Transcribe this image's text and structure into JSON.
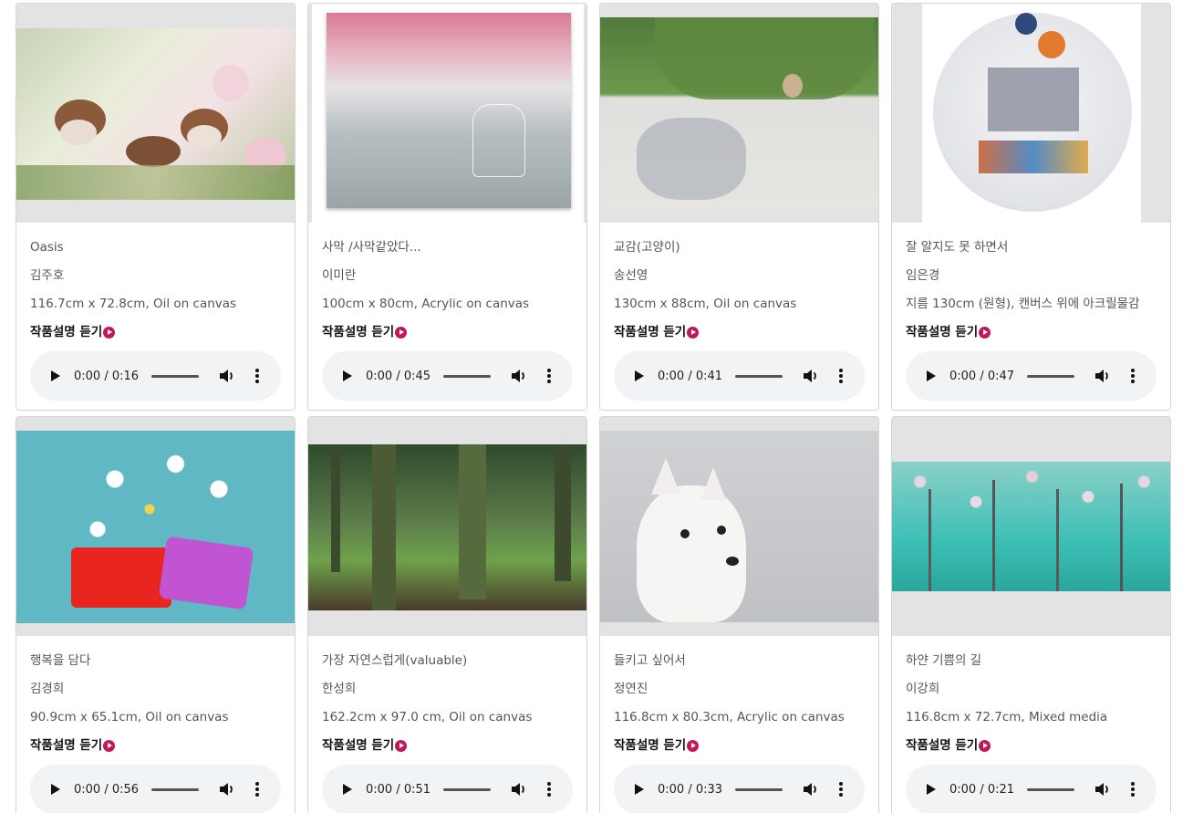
{
  "listen_label": "작품설명 듣기",
  "accent_color": "#c2185b",
  "artworks": [
    {
      "title": "Oasis",
      "artist": "김주호",
      "spec": "116.7cm x 72.8cm, Oil on canvas",
      "time": "0:00 / 0:16"
    },
    {
      "title": "사막 /사막같았다...",
      "artist": "이미란",
      "spec": "100cm x 80cm, Acrylic on canvas",
      "time": "0:00 / 0:45"
    },
    {
      "title": "교감(고양이)",
      "artist": "송선영",
      "spec": "130cm x 88cm, Oil on canvas",
      "time": "0:00 / 0:41"
    },
    {
      "title": "잘 알지도 못 하면서",
      "artist": "임은경",
      "spec": "지름 130cm (원형), 캔버스 위에 아크릴물감",
      "time": "0:00 / 0:47"
    },
    {
      "title": "행복을 담다",
      "artist": "김경희",
      "spec": "90.9cm x 65.1cm, Oil on canvas",
      "time": "0:00 / 0:56"
    },
    {
      "title": "가장 자연스럽게(valuable)",
      "artist": "한성희",
      "spec": "162.2cm x 97.0 cm, Oil on canvas",
      "time": "0:00 / 0:51"
    },
    {
      "title": "들키고 싶어서",
      "artist": "정연진",
      "spec": "116.8cm x 80.3cm, Acrylic on canvas",
      "time": "0:00 / 0:33"
    },
    {
      "title": "하얀 기쁨의 길",
      "artist": "이강희",
      "spec": "116.8cm x 72.7cm, Mixed media",
      "time": "0:00 / 0:21"
    }
  ]
}
